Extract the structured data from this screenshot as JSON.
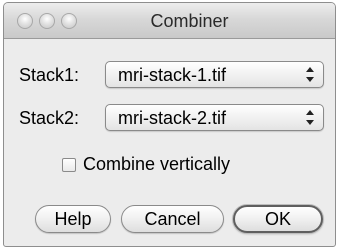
{
  "window": {
    "title": "Combiner"
  },
  "titlebar": {
    "buttons": [
      "close-button",
      "minimize-button",
      "zoom-button"
    ]
  },
  "form": {
    "stack1": {
      "label": "Stack1:",
      "value": "mri-stack-1.tif"
    },
    "stack2": {
      "label": "Stack2:",
      "value": "mri-stack-2.tif"
    },
    "combine_vertically": {
      "label": "Combine vertically",
      "checked": false
    }
  },
  "buttons": {
    "help": "Help",
    "cancel": "Cancel",
    "ok": "OK"
  }
}
